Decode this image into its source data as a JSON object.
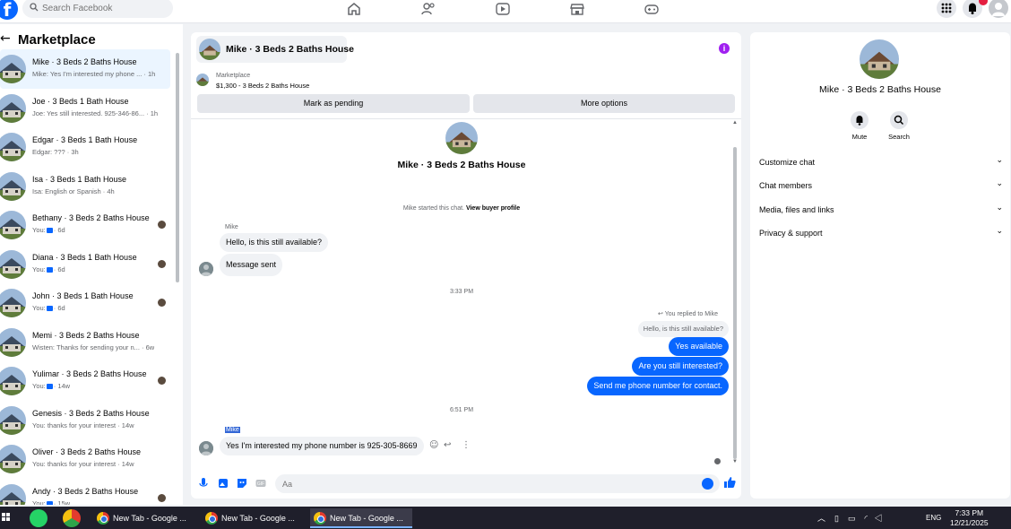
{
  "topbar": {
    "logo": "f",
    "search_placeholder": "Search Facebook",
    "nav_icons": [
      "home-icon",
      "friends-icon",
      "video-icon",
      "marketplace-icon",
      "gaming-icon"
    ],
    "right_icons": [
      "menu-grid-icon",
      "bell-icon",
      "account-icon"
    ],
    "notif_count": "",
    "accent": "#0866ff"
  },
  "left": {
    "back": "←",
    "title": "Marketplace",
    "conversations": [
      {
        "title": "Mike · 3 Beds 2 Baths House",
        "sub": "Mike: Yes I'm interested my phone ... · 1h",
        "active": true
      },
      {
        "title": "Joe · 3 Beds 1 Bath House",
        "sub": "Joe: Yes still interested. 925-346-86... · 1h"
      },
      {
        "title": "Edgar · 3 Beds 1 Bath House",
        "sub": "Edgar: ??? · 3h"
      },
      {
        "title": "Isa · 3 Beds 1 Bath House",
        "sub": "Isa: English or Spanish · 4h"
      },
      {
        "title": "Bethany · 3 Beds 2 Baths House",
        "sub_prefix": "You:",
        "sub_suffix": "· 6d"
      },
      {
        "title": "Diana · 3 Beds 1 Bath House",
        "sub_prefix": "You:",
        "sub_suffix": "· 6d"
      },
      {
        "title": "John · 3 Beds 1 Bath House",
        "sub_prefix": "You:",
        "sub_suffix": "· 6d"
      },
      {
        "title": "Memi · 3 Beds 2 Baths House",
        "sub": "Wisten: Thanks for sending your n... · 6w"
      },
      {
        "title": "Yulimar · 3 Beds 2 Baths House",
        "sub_prefix": "You:",
        "sub_suffix": "· 14w"
      },
      {
        "title": "Genesis · 3 Beds 2 Baths House",
        "sub": "You: thanks for your interest · 14w"
      },
      {
        "title": "Oliver · 3 Beds 2 Baths House",
        "sub": "You: thanks for your interest · 14w"
      },
      {
        "title": "Andy · 3 Beds 2 Baths House",
        "sub_prefix": "You:",
        "sub_suffix": "· 15w"
      }
    ]
  },
  "chat": {
    "title": "Mike · 3 Beds 2 Baths House",
    "marketplace_label": "Marketplace",
    "listing": "$1,300 - 3 Beds 2 Baths House",
    "mark_pending": "Mark as pending",
    "more_options": "More options",
    "header_title": "Mike · 3 Beds 2 Baths House",
    "started_text": "Mike started this chat.",
    "view_profile": "View buyer profile",
    "sender_name": "Mike",
    "msg_in_1": "Hello, is this still available?",
    "msg_in_2": "Message sent",
    "time_1": "3:33 PM",
    "replied_label": "You replied to Mike",
    "quoted": "Hello, is this still available?",
    "msg_out_1": "Yes available",
    "msg_out_2": "Are you still interested?",
    "msg_out_3": "Send me phone number for contact.",
    "time_2": "6:51 PM",
    "sender_name_2": "Mike",
    "msg_in_3": "Yes I'm interested my phone number is 925-305-8669",
    "input_placeholder": "Aa"
  },
  "right": {
    "title": "Mike · 3 Beds 2 Baths House",
    "mute": "Mute",
    "search": "Search",
    "sections": [
      "Customize chat",
      "Chat members",
      "Media, files and links",
      "Privacy & support"
    ]
  },
  "taskbar": {
    "tabs": [
      "New Tab - Google ...",
      "New Tab - Google ...",
      "New Tab - Google ..."
    ],
    "lang": "ENG",
    "time": "7:33 PM",
    "date": "12/21/2025"
  }
}
